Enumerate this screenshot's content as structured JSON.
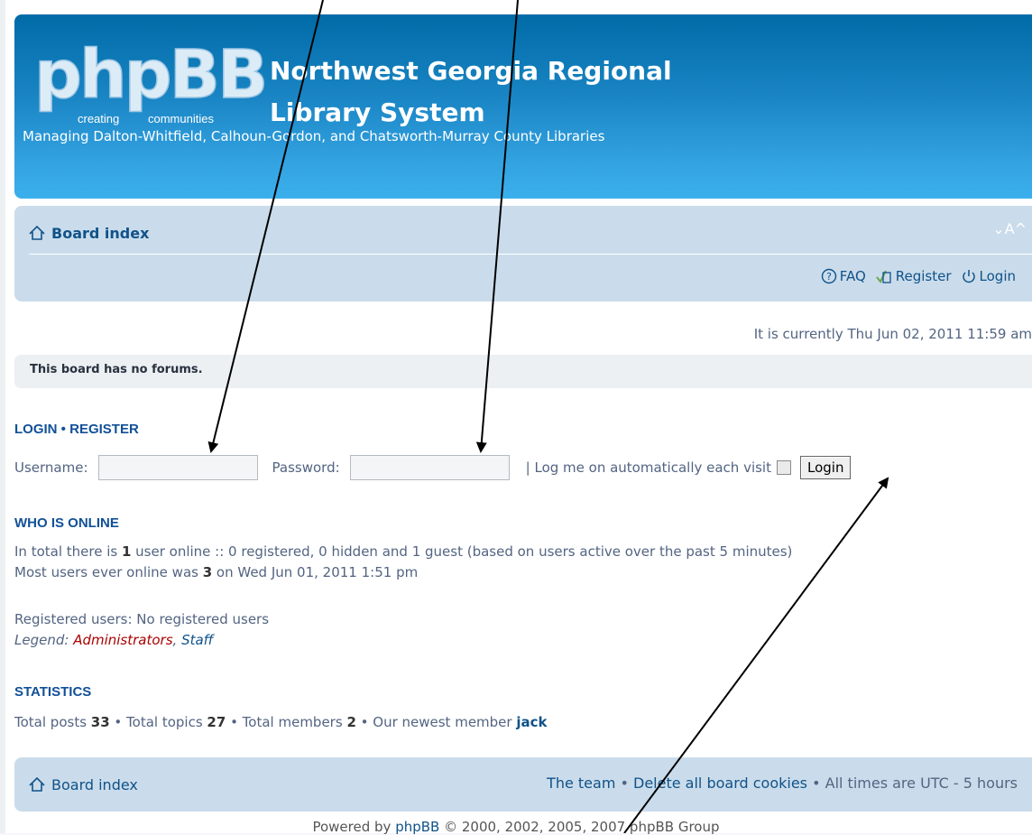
{
  "header": {
    "logo_text": "phpBB",
    "logo_tagline_left": "creating",
    "logo_tagline_right": "communities",
    "site_title": "Northwest Georgia Regional Library System",
    "site_description": "Managing Dalton-Whitfield, Calhoun-Gordon, and Chatsworth-Murray County Libraries",
    "colors": {
      "header_blue": "#1a85c4",
      "navbar": "#cadceb",
      "link": "#105289"
    }
  },
  "navbar": {
    "board_index": "Board index",
    "font_size_control": "⌄A^",
    "links": [
      {
        "label": "FAQ",
        "icon": "faq-icon"
      },
      {
        "label": "Register",
        "icon": "register-icon"
      },
      {
        "label": "Login",
        "icon": "power-icon"
      }
    ]
  },
  "current_time": "It is currently Thu Jun 02, 2011 11:59 am",
  "no_forums": "This board has no forums.",
  "login": {
    "heading_login": "LOGIN",
    "heading_sep": "•",
    "heading_register": "REGISTER",
    "username_label": "Username:",
    "username_value": "",
    "password_label": "Password:",
    "password_value": "",
    "autologin_label": "| Log me on automatically each visit",
    "autologin_checked": false,
    "button": "Login"
  },
  "who_is_online": {
    "heading": "WHO IS ONLINE",
    "line1_pre": "In total there is ",
    "line1_count": "1",
    "line1_post": " user online :: 0 registered, 0 hidden and 1 guest (based on users active over the past 5 minutes)",
    "line2_pre": "Most users ever online was ",
    "line2_count": "3",
    "line2_post": " on Wed Jun 01, 2011 1:51 pm",
    "registered_users": "Registered users: No registered users",
    "legend_label": "Legend: ",
    "legend_admins": "Administrators",
    "legend_sep": ", ",
    "legend_staff": "Staff"
  },
  "statistics": {
    "heading": "STATISTICS",
    "posts_label": "Total posts ",
    "posts": "33",
    "topics_label": " • Total topics ",
    "topics": "27",
    "members_label": " • Total members ",
    "members": "2",
    "newest_label": " • Our newest member ",
    "newest": "jack"
  },
  "footer": {
    "board_index": "Board index",
    "team": "The team",
    "sep1": " • ",
    "delete_cookies": "Delete all board cookies",
    "sep2": " • ",
    "timezone": "All times are UTC - 5 hours"
  },
  "powered": {
    "pre": "Powered by ",
    "link": "phpBB",
    "post": " © 2000, 2002, 2005, 2007 phpBB Group"
  }
}
